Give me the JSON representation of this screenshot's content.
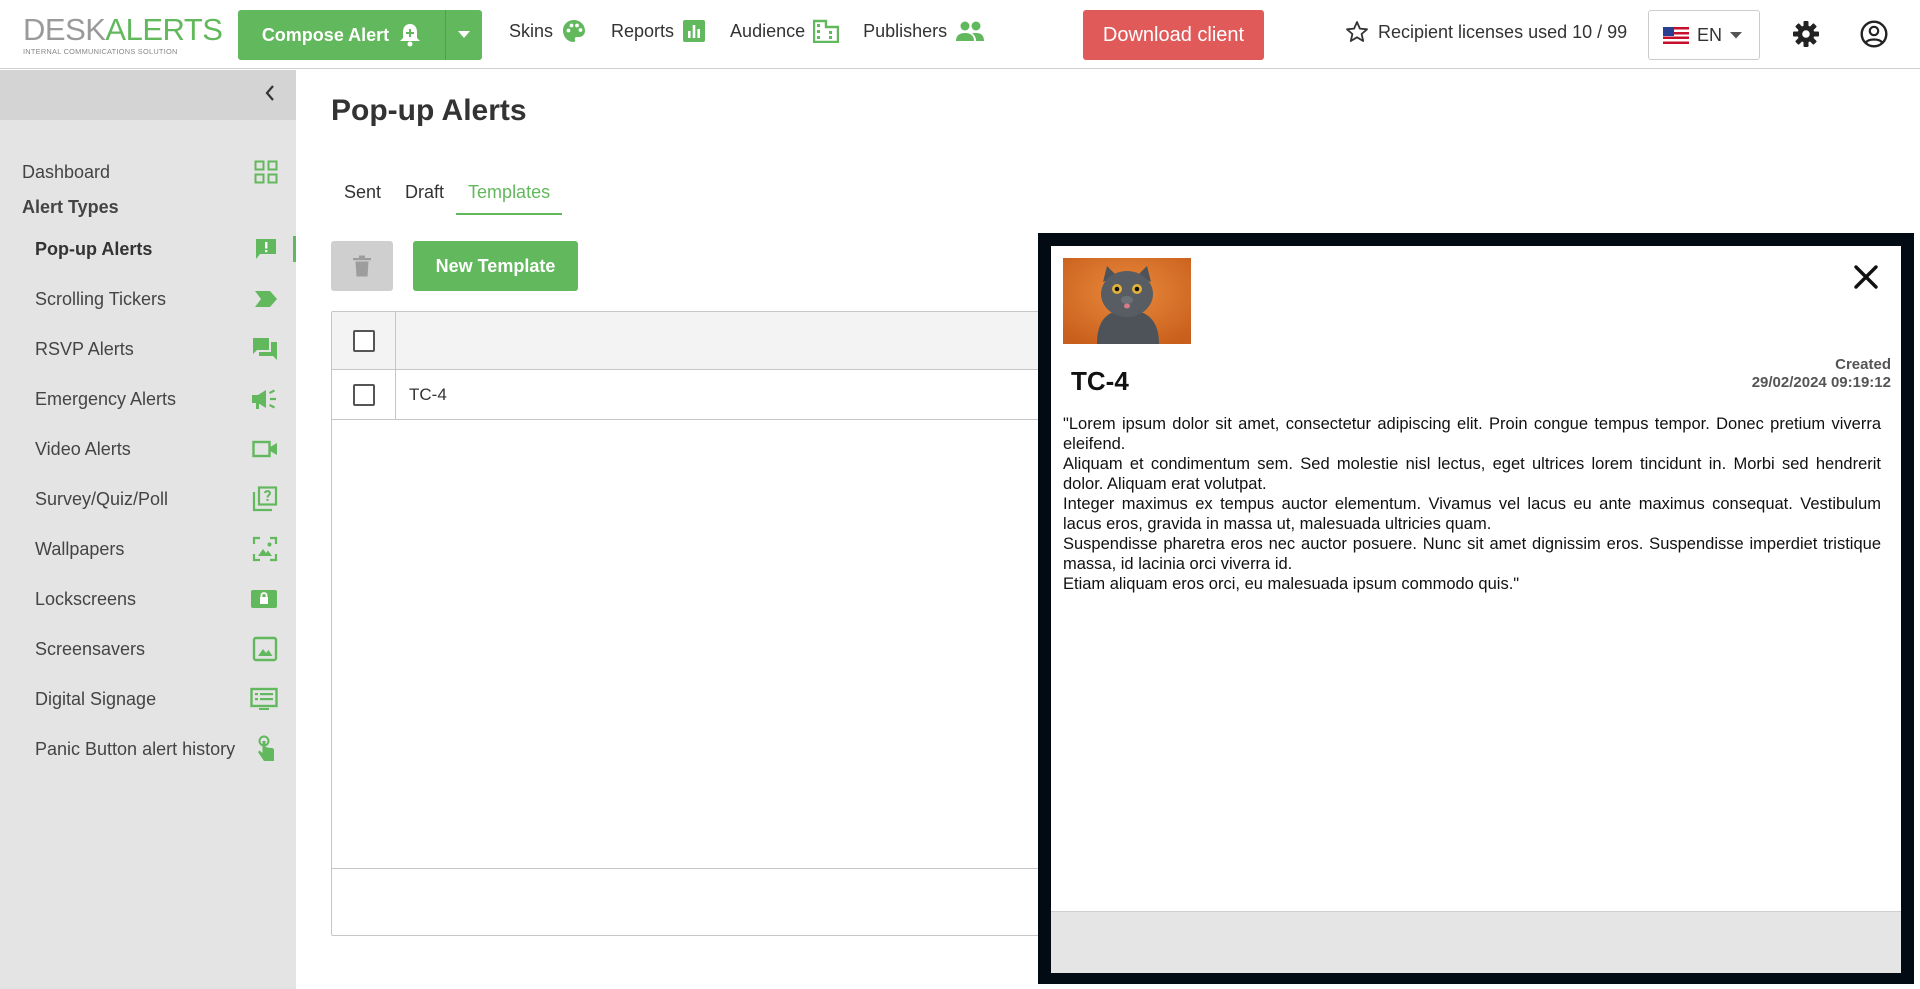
{
  "brand": {
    "logo_part1": "DESK",
    "logo_part2": "ALERTS",
    "tagline": "INTERNAL COMMUNICATIONS SOLUTION",
    "accent": "#62b85c"
  },
  "header": {
    "compose_label": "Compose Alert",
    "nav": [
      {
        "label": "Skins",
        "icon": "palette-icon"
      },
      {
        "label": "Reports",
        "icon": "bar-chart-icon"
      },
      {
        "label": "Audience",
        "icon": "building-icon"
      },
      {
        "label": "Publishers",
        "icon": "people-icon"
      }
    ],
    "download_label": "Download client",
    "download_color": "#e05a5a",
    "licenses_label": "Recipient licenses used 10 / 99",
    "language": "EN"
  },
  "sidebar": {
    "dashboard": "Dashboard",
    "section_heading": "Alert Types",
    "items": [
      {
        "label": "Pop-up Alerts",
        "icon": "alert-bubble-icon",
        "active": true
      },
      {
        "label": "Scrolling Tickers",
        "icon": "ticker-tag-icon"
      },
      {
        "label": "RSVP Alerts",
        "icon": "chat-bubbles-icon"
      },
      {
        "label": "Emergency Alerts",
        "icon": "megaphone-icon"
      },
      {
        "label": "Video Alerts",
        "icon": "video-camera-icon"
      },
      {
        "label": "Survey/Quiz/Poll",
        "icon": "quiz-icon"
      },
      {
        "label": "Wallpapers",
        "icon": "wallpaper-icon"
      },
      {
        "label": "Lockscreens",
        "icon": "lockscreen-icon"
      },
      {
        "label": "Screensavers",
        "icon": "image-icon"
      },
      {
        "label": "Digital Signage",
        "icon": "signage-icon"
      },
      {
        "label": "Panic Button alert history",
        "icon": "touch-icon"
      }
    ]
  },
  "main": {
    "title": "Pop-up Alerts",
    "tabs": [
      {
        "label": "Sent"
      },
      {
        "label": "Draft"
      },
      {
        "label": "Templates",
        "active": true
      }
    ],
    "new_template_label": "New Template",
    "rows": [
      {
        "name": "TC-4"
      }
    ]
  },
  "preview": {
    "title": "TC-4",
    "created_label": "Created",
    "created_date": "29/02/2024 09:19:12",
    "paragraphs": [
      "\"Lorem ipsum dolor sit amet, consectetur adipiscing elit. Proin congue tempus tempor. Donec pretium viverra eleifend.",
      "Aliquam et condimentum sem. Sed molestie nisl lectus, eget ultrices lorem tincidunt in. Morbi sed hendrerit dolor. Aliquam erat volutpat.",
      "Integer maximus ex tempus auctor elementum. Vivamus vel lacus eu ante maximus consequat. Vestibulum lacus eros, gravida in massa ut, malesuada ultricies quam.",
      "Suspendisse pharetra eros nec auctor posuere. Nunc sit amet dignissim eros. Suspendisse imperdiet tristique massa, id lacinia orci viverra id.",
      "Etiam aliquam eros orci, eu malesuada ipsum commodo quis.\""
    ]
  }
}
